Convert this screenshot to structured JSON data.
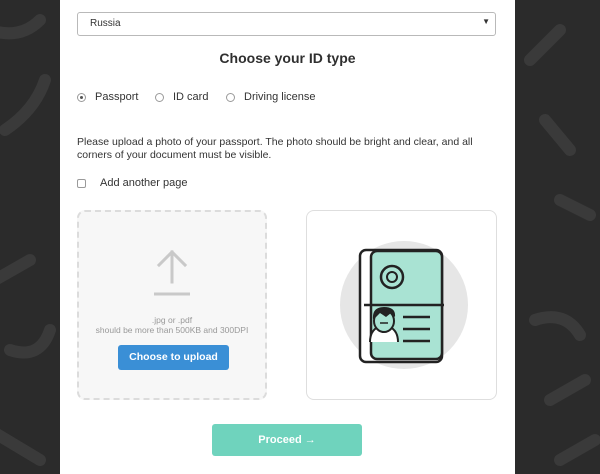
{
  "form": {
    "country_value": "Russia",
    "id_type_title": "Choose your ID type",
    "id_types": [
      {
        "label": "Passport",
        "selected": true
      },
      {
        "label": "ID card",
        "selected": false
      },
      {
        "label": "Driving license",
        "selected": false
      }
    ],
    "instructions": "Please upload a photo of your passport. The photo should be bright and clear, and all corners of your document must be visible.",
    "add_page_label": "Add another page",
    "add_page_checked": false
  },
  "upload": {
    "file_types": ".jpg or .pdf",
    "requirements": "should be more than 500KB and 300DPI",
    "choose_label": "Choose to upload"
  },
  "footer": {
    "proceed_label": "Proceed →"
  },
  "colors": {
    "background": "#2b2b2b",
    "upload_button": "#3a8fd6",
    "proceed_button": "#6fd3bd",
    "passport_page": "#a9e3d3"
  }
}
